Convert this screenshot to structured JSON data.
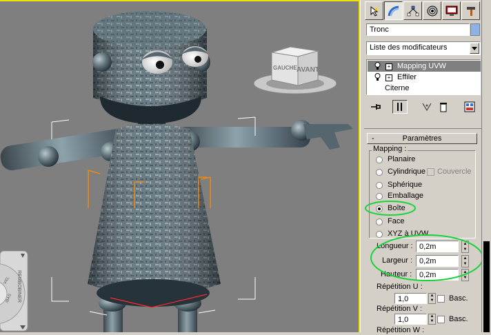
{
  "viewport": {
    "viewcube_labels": [
      "GAUCHE",
      "AVANT"
    ],
    "nav_wheel_label": "REMBOBINER",
    "nav_wheel_small_labels": [
      "VIG.",
      "/BAS"
    ]
  },
  "command_panel": {
    "tabs": [
      {
        "name": "create",
        "icon": "pointer-icon"
      },
      {
        "name": "modify",
        "icon": "modify-arc-icon"
      },
      {
        "name": "hierarchy",
        "icon": "hierarchy-icon"
      },
      {
        "name": "motion",
        "icon": "motion-icon"
      },
      {
        "name": "display",
        "icon": "display-monitor-icon"
      },
      {
        "name": "utilities",
        "icon": "hammer-icon"
      }
    ],
    "object_name": "Tronc",
    "object_color": "#8eb1e8",
    "modifier_list": "Liste des modificateurs",
    "stack": [
      {
        "label": "Mapping UVW",
        "selected": true
      },
      {
        "label": "Effiler",
        "selected": false
      },
      {
        "label": "Citerne",
        "selected": false
      }
    ]
  },
  "parametres": {
    "title": "Paramètres",
    "collapse": "-",
    "mapping_group": "Mapping :",
    "options": [
      {
        "label": "Planaire",
        "selected": false
      },
      {
        "label": "Cylindrique",
        "selected": false
      },
      {
        "label": "Sphérique",
        "selected": false
      },
      {
        "label": "Emballage",
        "selected": false
      },
      {
        "label": "Boîte",
        "selected": true
      },
      {
        "label": "Face",
        "selected": false
      },
      {
        "label": "XYZ à UVW",
        "selected": false
      }
    ],
    "couvercle_label": "Couvercle",
    "longueur_label": "Longueur :",
    "longueur_value": "0,2m",
    "largeur_label": "Largeur :",
    "largeur_value": "0,2m",
    "hauteur_label": "Hauteur :",
    "hauteur_value": "0,2m",
    "rep_u_label": "Répétition U :",
    "rep_u_value": "1,0",
    "rep_v_label": "Répétition V :",
    "rep_v_value": "1,0",
    "rep_w_label": "Répétition W :",
    "basc_label": "Basc."
  },
  "highlight_color": "#19d23a"
}
